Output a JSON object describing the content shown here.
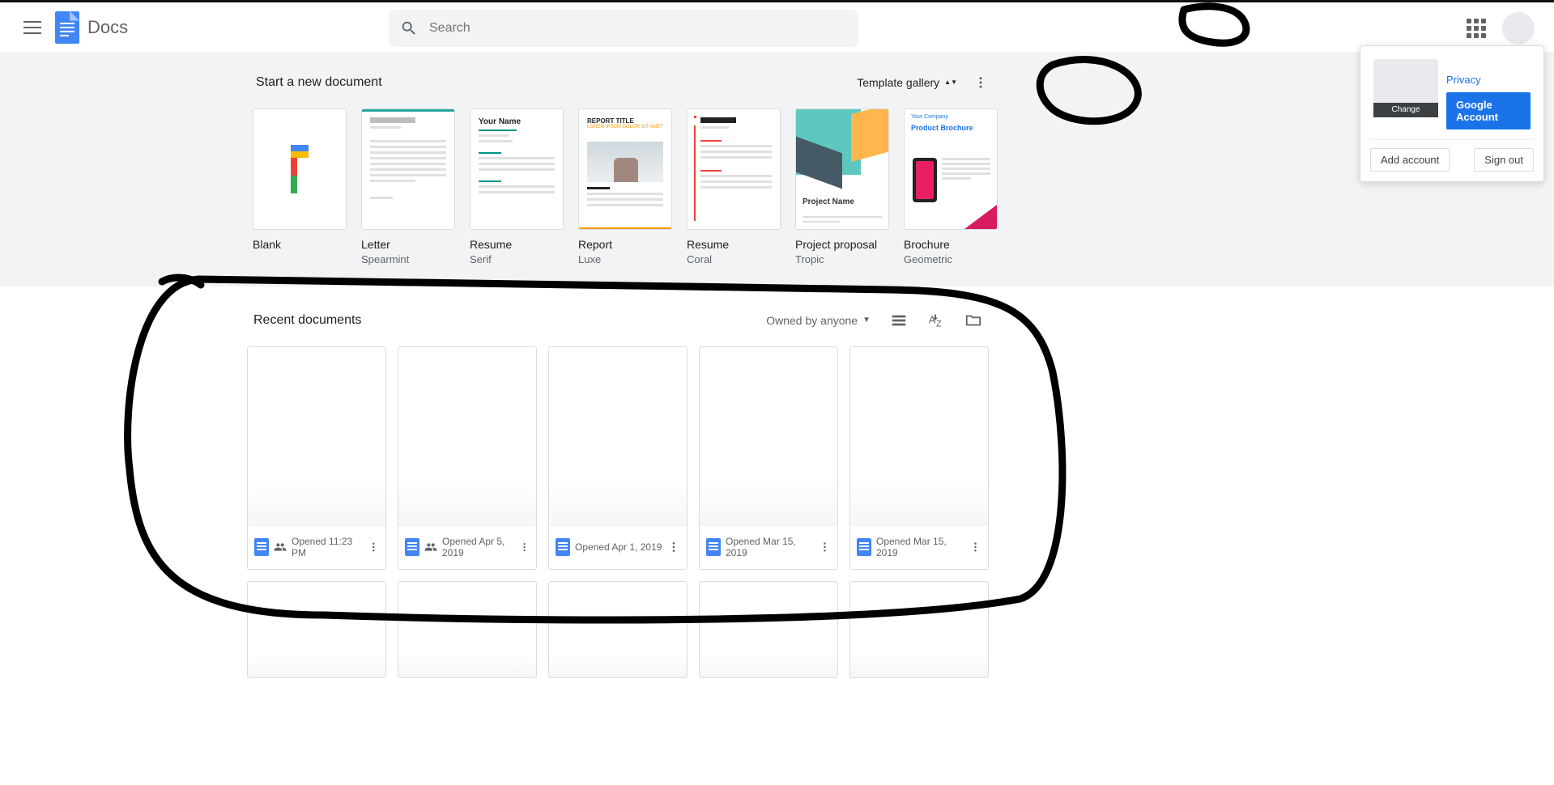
{
  "header": {
    "app_name": "Docs",
    "search_placeholder": "Search"
  },
  "template_section": {
    "title": "Start a new document",
    "gallery_link": "Template gallery",
    "templates": [
      {
        "name": "Blank",
        "sub": ""
      },
      {
        "name": "Letter",
        "sub": "Spearmint"
      },
      {
        "name": "Resume",
        "sub": "Serif"
      },
      {
        "name": "Report",
        "sub": "Luxe"
      },
      {
        "name": "Resume",
        "sub": "Coral"
      },
      {
        "name": "Project proposal",
        "sub": "Tropic"
      },
      {
        "name": "Brochure",
        "sub": "Geometric"
      }
    ],
    "thumb_labels": {
      "report_title": "REPORT TITLE",
      "report_sub": "LOREM IPSUM DOLOR SIT AMET",
      "resume_your_name": "Your Name",
      "project_name": "Project Name",
      "brochure_company": "Your Company",
      "brochure_title": "Product Brochure"
    }
  },
  "recent_section": {
    "title": "Recent documents",
    "owned_filter": "Owned by anyone",
    "docs": [
      {
        "opened": "Opened 11:23 PM",
        "shared": true
      },
      {
        "opened": "Opened Apr 5, 2019",
        "shared": true
      },
      {
        "opened": "Opened Apr 1, 2019",
        "shared": false
      },
      {
        "opened": "Opened Mar 15, 2019",
        "shared": false
      },
      {
        "opened": "Opened Mar 15, 2019",
        "shared": false
      }
    ]
  },
  "account_popup": {
    "change": "Change",
    "privacy": "Privacy",
    "google_account": "Google Account",
    "add_account": "Add account",
    "sign_out": "Sign out"
  }
}
